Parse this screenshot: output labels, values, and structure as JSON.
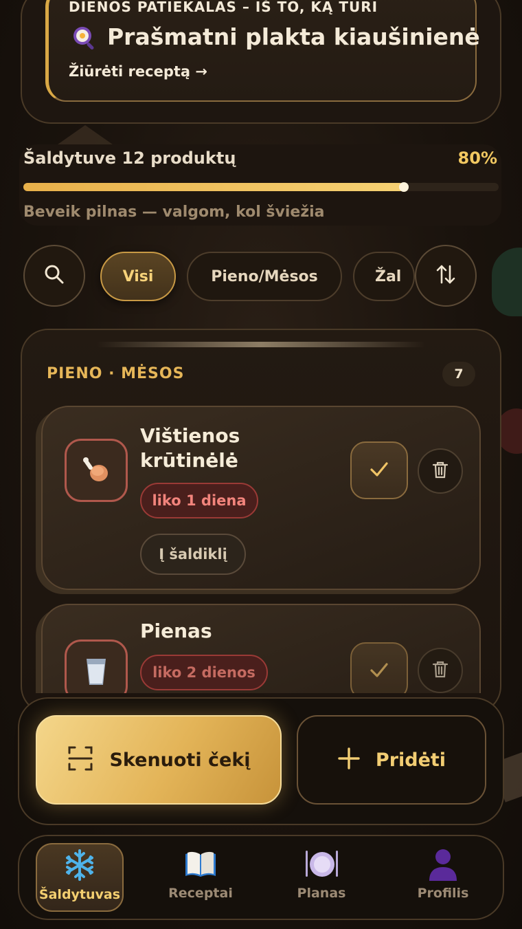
{
  "dish_of_day": {
    "kicker": "DIENOS PATIEKALAS – IŠ TO, KĄ TURI",
    "title": "Prašmatni plakta kiaušinienė",
    "link": "Žiūrėti receptą →",
    "icon": "frying-pan-egg-icon"
  },
  "fridge": {
    "label": "Šaldytuve 12 produktų",
    "percent_label": "80%",
    "fill_fraction": 0.8,
    "note": "Beveik pilnas — valgom, kol šviežia"
  },
  "filters": {
    "search_icon": "search-icon",
    "sort_icon": "sort-icon",
    "chips": [
      {
        "label": "Visi",
        "active": true
      },
      {
        "label": "Pieno/Mėsos",
        "active": false
      },
      {
        "label": "Žal",
        "active": false
      }
    ]
  },
  "section": {
    "title": "PIENO · MĖSOS",
    "count": "7"
  },
  "items": [
    {
      "name_line1": "Vištienos",
      "name_line2": "krūtinėlė",
      "expiry": "liko 1 diena",
      "freeze_label": "Į šaldiklį",
      "icon": "chicken-leg-icon"
    },
    {
      "name_line1": "Pienas",
      "expiry": "liko 2 dienos",
      "icon": "milk-glass-icon"
    }
  ],
  "actions": {
    "scan_label": "Skenuoti čekį",
    "add_label": "Pridėti"
  },
  "nav": [
    {
      "label": "Šaldytuvas",
      "icon": "snowflake-icon",
      "active": true
    },
    {
      "label": "Receptai",
      "icon": "book-icon",
      "active": false
    },
    {
      "label": "Planas",
      "icon": "plate-icon",
      "active": false
    },
    {
      "label": "Profilis",
      "icon": "person-icon",
      "active": false
    }
  ],
  "colors": {
    "accent_gold": "#f2c861",
    "danger": "#f2847c",
    "background": "#1a130d"
  }
}
